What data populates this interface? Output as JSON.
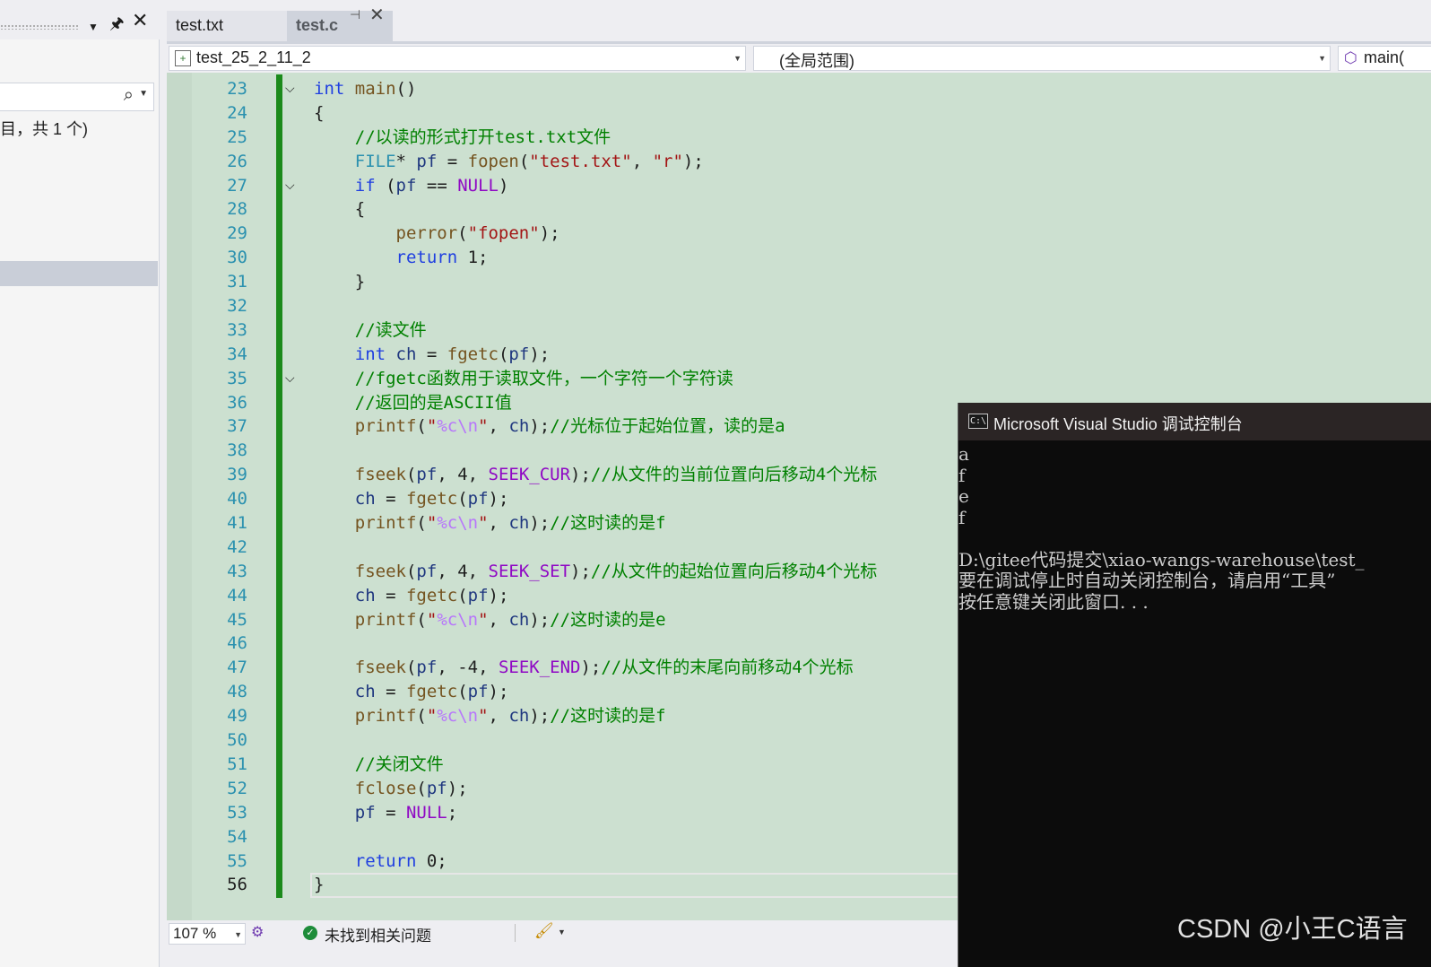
{
  "left_panel": {
    "pin_icon": "pin-icon",
    "close_icon": "close-icon",
    "search_icon": "search-icon",
    "count_text": "目，共 1 个)"
  },
  "tabs": [
    {
      "label": "test.txt",
      "active": false
    },
    {
      "label": "test.c",
      "active": true
    }
  ],
  "nav": {
    "project": "test_25_2_11_2",
    "scope": "(全局范围)",
    "function": "main("
  },
  "editor": {
    "current_line": 56,
    "lines": [
      {
        "n": "23",
        "code": "int main()",
        "fold": true
      },
      {
        "n": "24",
        "code": "{"
      },
      {
        "n": "25",
        "code": "    //以读的形式打开test.txt文件"
      },
      {
        "n": "26",
        "code": "    FILE* pf = fopen(\"test.txt\", \"r\");"
      },
      {
        "n": "27",
        "code": "    if (pf == NULL)",
        "fold": true
      },
      {
        "n": "28",
        "code": "    {"
      },
      {
        "n": "29",
        "code": "        perror(\"fopen\");"
      },
      {
        "n": "30",
        "code": "        return 1;"
      },
      {
        "n": "31",
        "code": "    }"
      },
      {
        "n": "32",
        "code": ""
      },
      {
        "n": "33",
        "code": "    //读文件"
      },
      {
        "n": "34",
        "code": "    int ch = fgetc(pf);"
      },
      {
        "n": "35",
        "code": "    //fgetc函数用于读取文件，一个字符一个字符读",
        "fold": true
      },
      {
        "n": "36",
        "code": "    //返回的是ASCII值"
      },
      {
        "n": "37",
        "code": "    printf(\"%c\\n\", ch);//光标位于起始位置，读的是a"
      },
      {
        "n": "38",
        "code": ""
      },
      {
        "n": "39",
        "code": "    fseek(pf, 4, SEEK_CUR);//从文件的当前位置向后移动4个光标"
      },
      {
        "n": "40",
        "code": "    ch = fgetc(pf);"
      },
      {
        "n": "41",
        "code": "    printf(\"%c\\n\", ch);//这时读的是f"
      },
      {
        "n": "42",
        "code": ""
      },
      {
        "n": "43",
        "code": "    fseek(pf, 4, SEEK_SET);//从文件的起始位置向后移动4个光标"
      },
      {
        "n": "44",
        "code": "    ch = fgetc(pf);"
      },
      {
        "n": "45",
        "code": "    printf(\"%c\\n\", ch);//这时读的是e"
      },
      {
        "n": "46",
        "code": ""
      },
      {
        "n": "47",
        "code": "    fseek(pf, -4, SEEK_END);//从文件的末尾向前移动4个光标"
      },
      {
        "n": "48",
        "code": "    ch = fgetc(pf);"
      },
      {
        "n": "49",
        "code": "    printf(\"%c\\n\", ch);//这时读的是f"
      },
      {
        "n": "50",
        "code": ""
      },
      {
        "n": "51",
        "code": "    //关闭文件"
      },
      {
        "n": "52",
        "code": "    fclose(pf);"
      },
      {
        "n": "53",
        "code": "    pf = NULL;"
      },
      {
        "n": "54",
        "code": ""
      },
      {
        "n": "55",
        "code": "    return 0;"
      },
      {
        "n": "56",
        "code": "}"
      }
    ]
  },
  "status": {
    "zoom": "107 %",
    "issues": "未找到相关问题"
  },
  "console": {
    "title": "Microsoft Visual Studio 调试控制台",
    "icon_text": "C:\\",
    "lines": [
      "a",
      "f",
      "e",
      "f",
      "",
      "D:\\gitee代码提交\\xiao-wangs-warehouse\\test_",
      "要在调试停止时自动关闭控制台，请启用“工具”",
      "按任意键关闭此窗口. . ."
    ]
  },
  "watermark": "CSDN @小王C语言",
  "colors": {
    "editor_bg": "#cce0d0",
    "keyword": "#1f3fe0",
    "comment": "#008000",
    "string": "#a31515",
    "macro": "#8f08c4",
    "change_bar": "#1b8a1b",
    "console_bg": "#0c0c0c"
  }
}
